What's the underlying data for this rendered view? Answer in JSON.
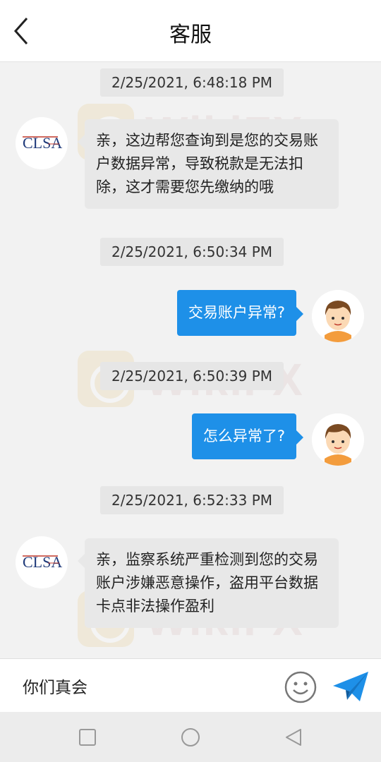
{
  "header": {
    "title": "客服",
    "back_icon": "back-arrow-icon"
  },
  "watermark": {
    "text": "WikiFX"
  },
  "messages": [
    {
      "time": "2/25/2021, 6:48:18 PM"
    },
    {
      "sender": "agent",
      "avatar": "clsa-logo-icon",
      "text_lines": [
        "亲，这边帮您查询到是您的交易账",
        "户数据异常，导致税款是无法扣",
        "除，这才需要您先缴纳的哦"
      ]
    },
    {
      "time": "2/25/2021, 6:50:34 PM"
    },
    {
      "sender": "user",
      "avatar": "boy-avatar-icon",
      "text": "交易账户异常?"
    },
    {
      "time": "2/25/2021, 6:50:39 PM"
    },
    {
      "sender": "user",
      "avatar": "boy-avatar-icon",
      "text": "怎么异常了?"
    },
    {
      "time": "2/25/2021, 6:52:33 PM"
    },
    {
      "sender": "agent",
      "avatar": "clsa-logo-icon",
      "text_lines": [
        "亲，监察系统严重检测到您的交易",
        "账户涉嫌恶意操作，盗用平台数据",
        "卡点非法操作盈利"
      ]
    }
  ],
  "input": {
    "value": "你们真会",
    "emoji_icon": "smiley-icon",
    "send_icon": "send-paper-plane-icon"
  },
  "system_nav": {
    "recent_icon": "square-recents-icon",
    "home_icon": "circle-home-icon",
    "back_icon": "triangle-back-icon"
  },
  "colors": {
    "accent": "#1e90e8",
    "bubble_in": "#e8e8e8",
    "background": "#f2f2f2"
  }
}
